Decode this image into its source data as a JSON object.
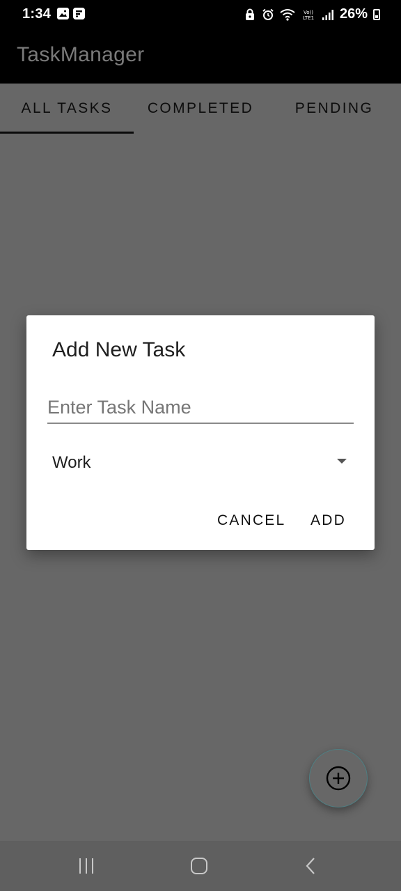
{
  "status_bar": {
    "time": "1:34",
    "battery": "26%",
    "icons": [
      "gallery-icon",
      "flipboard-icon",
      "vpn-icon",
      "alarm-icon",
      "wifi-icon",
      "volte-icon",
      "signal-icon",
      "battery-icon"
    ]
  },
  "app_bar": {
    "title": "TaskManager"
  },
  "tabs": [
    {
      "label": "ALL TASKS",
      "active": true
    },
    {
      "label": "COMPLETED",
      "active": false
    },
    {
      "label": "PENDING",
      "active": false
    }
  ],
  "dialog": {
    "title": "Add New Task",
    "task_input": {
      "placeholder": "Enter Task Name",
      "value": ""
    },
    "category": {
      "selected": "Work"
    },
    "cancel_label": "CANCEL",
    "add_label": "ADD"
  },
  "fab": {
    "icon": "add-circle-icon"
  },
  "nav_bar": {
    "icons": [
      "recent-apps-icon",
      "home-icon",
      "back-icon"
    ]
  },
  "colors": {
    "scrim": "#676767",
    "app_bar": "#000000",
    "title_text": "#7a7a7a",
    "dialog_bg": "#ffffff",
    "fab_border": "#4f7f83"
  }
}
